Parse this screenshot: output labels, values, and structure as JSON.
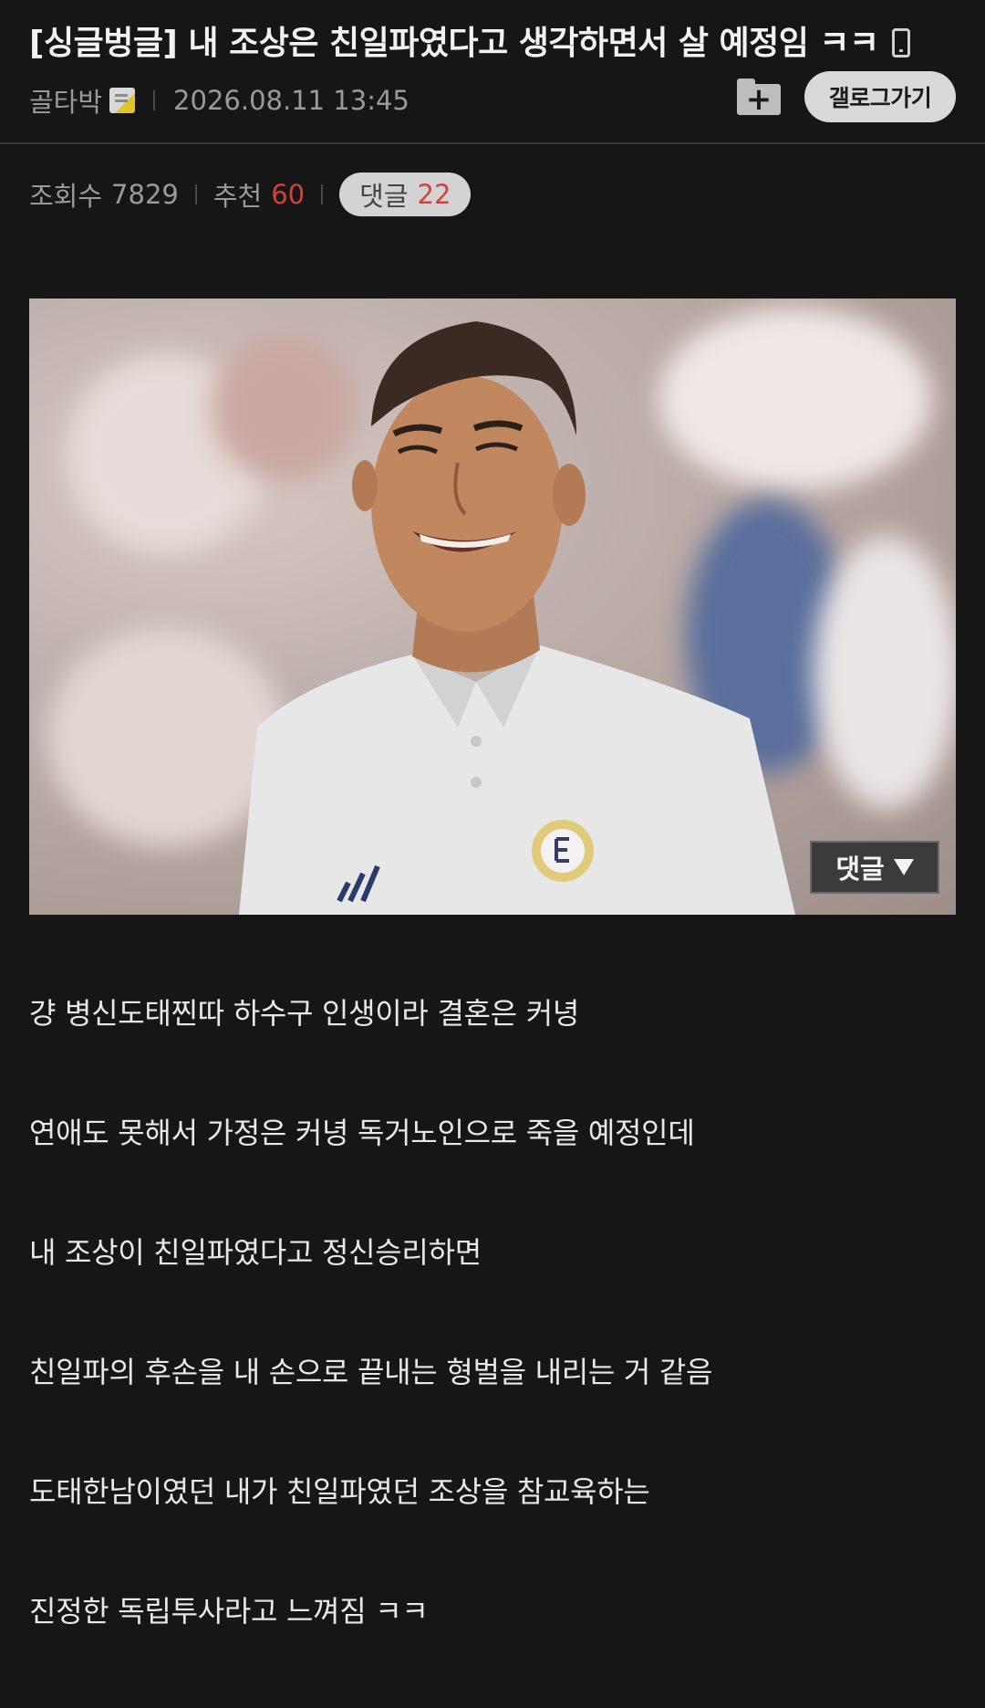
{
  "post": {
    "title": "[싱글벙글] 내 조상은 친일파였다고 생각하면서 살 예정임 ㅋㅋ",
    "author": "골타박",
    "datetime": "2026.08.11 13:45",
    "gallery_button": "갤로그가기",
    "views_label": "조회수",
    "views": "7829",
    "recommend_label": "추천",
    "recommend": "60",
    "comments_label": "댓글",
    "comments": "22"
  },
  "image": {
    "comment_overlay_label": "댓글"
  },
  "content": {
    "lines": [
      "걍 병신도태찐따 하수구 인생이라 결혼은 커녕",
      "연애도 못해서 가정은 커녕 독거노인으로 죽을 예정인데",
      "내 조상이 친일파였다고 정신승리하면",
      "친일파의 후손을 내 손으로 끝내는 형벌을 내리는 거 같음",
      "도태한남이였던 내가 친일파였던 조상을 참교육하는",
      "진정한 독립투사라고 느껴짐 ㅋㅋ"
    ]
  },
  "colors": {
    "background": "#161616",
    "accent_red": "#d3413c",
    "pill_bg": "#d3d3d3"
  },
  "icons": [
    "mobile-phone-icon",
    "level-badge-icon",
    "folder-add-icon",
    "chevron-down-icon"
  ]
}
